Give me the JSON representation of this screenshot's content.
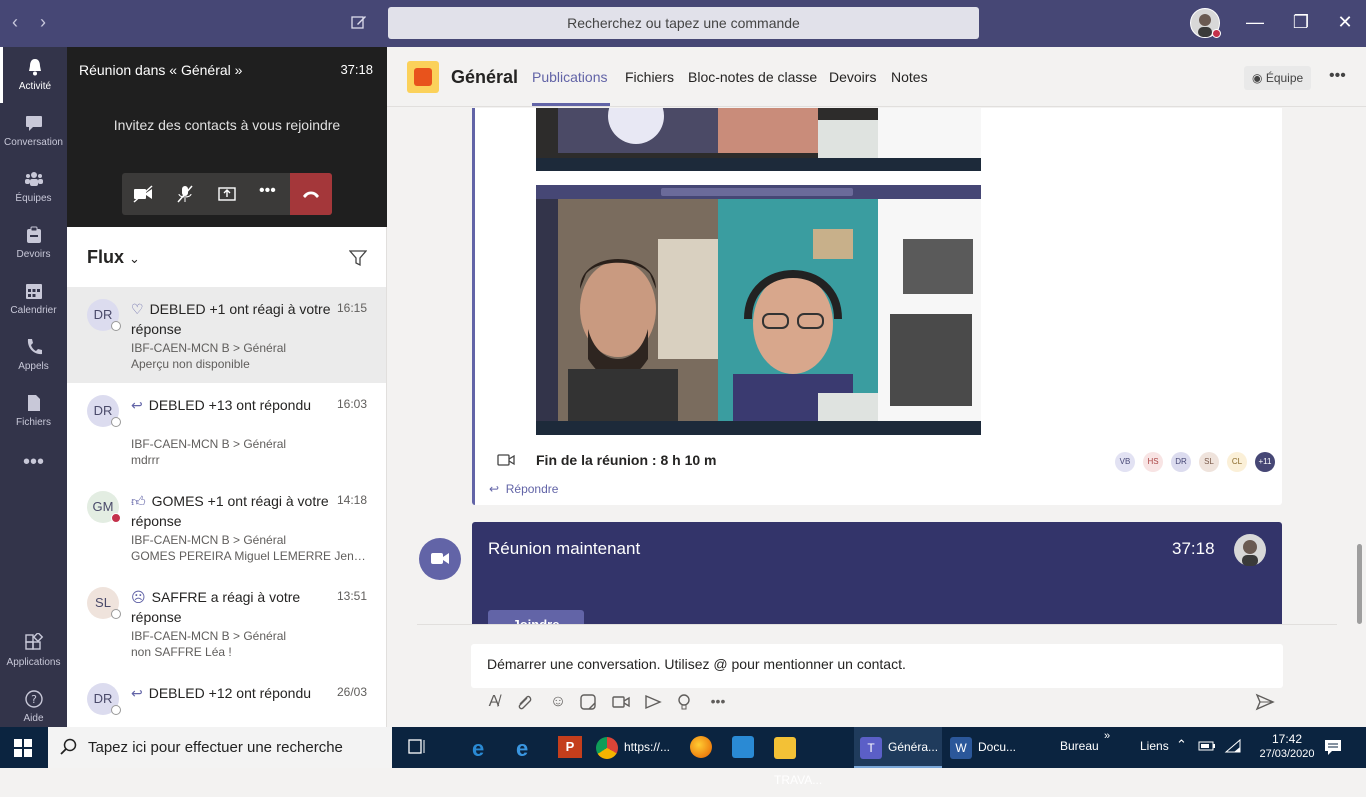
{
  "titlebar": {
    "search_placeholder": "Recherchez ou tapez une commande"
  },
  "rail": {
    "items": [
      {
        "label": "Activité",
        "icon": "bell-icon"
      },
      {
        "label": "Conversation",
        "icon": "chat-icon"
      },
      {
        "label": "Équipes",
        "icon": "teams-icon"
      },
      {
        "label": "Devoirs",
        "icon": "assignments-icon"
      },
      {
        "label": "Calendrier",
        "icon": "calendar-icon"
      },
      {
        "label": "Appels",
        "icon": "phone-icon"
      },
      {
        "label": "Fichiers",
        "icon": "files-icon"
      },
      {
        "label": "Applications",
        "icon": "apps-icon"
      },
      {
        "label": "Aide",
        "icon": "help-icon"
      }
    ]
  },
  "call": {
    "title": "Réunion dans « Général »",
    "timer": "37:18",
    "invite_text": "Invitez des contacts à vous rejoindre"
  },
  "feed": {
    "title": "Flux",
    "items": [
      {
        "initials": "DR",
        "title": "DEBLED +1 ont réagi à votre réponse",
        "time": "16:15",
        "path": "IBF-CAEN-MCN B > Général",
        "preview": "Aperçu non disponible",
        "icon": "heart-icon"
      },
      {
        "initials": "DR",
        "title": "DEBLED +13 ont répondu",
        "time": "16:03",
        "path": "IBF-CAEN-MCN B > Général",
        "preview": "mdrrr",
        "icon": "reply-icon"
      },
      {
        "initials": "GM",
        "title": "GOMES +1 ont réagi à votre réponse",
        "time": "14:18",
        "path": "IBF-CAEN-MCN B > Général",
        "preview": "GOMES PEREIRA Miguel LEMERRE Jennifer...",
        "icon": "like-icon"
      },
      {
        "initials": "SL",
        "title": "SAFFRE a réagi à votre réponse",
        "time": "13:51",
        "path": "IBF-CAEN-MCN B > Général",
        "preview": "non SAFFRE Léa !",
        "icon": "sad-icon"
      },
      {
        "initials": "DR",
        "title": "DEBLED +12 ont répondu",
        "time": "26/03",
        "path": "",
        "preview": "",
        "icon": "reply-icon"
      }
    ]
  },
  "channel": {
    "name": "Général",
    "tabs": [
      "Publications",
      "Fichiers",
      "Bloc-notes de classe",
      "Devoirs",
      "Notes"
    ],
    "team_button": "Équipe"
  },
  "post": {
    "meeting_end": "Fin de la réunion : 8 h 10 m",
    "reply": "Répondre",
    "participants": [
      "VB",
      "HS",
      "DR",
      "SL",
      "CL",
      "+11"
    ]
  },
  "meeting_now": {
    "title": "Réunion maintenant",
    "timer": "37:18",
    "join": "Joindre"
  },
  "composer": {
    "placeholder": "Démarrer une conversation. Utilisez @ pour mentionner un contact."
  },
  "taskbar": {
    "search": "Tapez ici pour effectuer une recherche",
    "apps": [
      {
        "label": "https://...",
        "icon": "chrome-icon"
      },
      {
        "label": "TRAVA...",
        "icon": "folder-icon"
      },
      {
        "label": "Généra...",
        "icon": "teams-app-icon"
      },
      {
        "label": "Docu...",
        "icon": "word-icon"
      }
    ],
    "bureau": "Bureau",
    "liens": "Liens",
    "time": "17:42",
    "date": "27/03/2020"
  }
}
